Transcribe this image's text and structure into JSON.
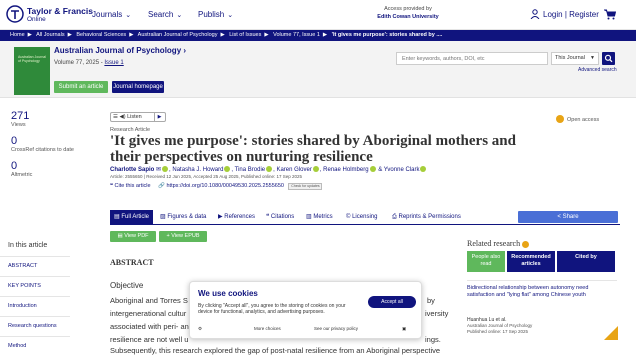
{
  "header": {
    "logo_line1": "Taylor & Francis",
    "logo_line2": "Online",
    "nav": [
      {
        "label": "Journals"
      },
      {
        "label": "Search"
      },
      {
        "label": "Publish"
      }
    ],
    "access_line1": "Access provided by",
    "access_line2": "Edith Cowan University",
    "login": "Login",
    "separator": "|",
    "register": "Register"
  },
  "breadcrumb": [
    "Home",
    "All Journals",
    "Behavioral Sciences",
    "Australian Journal of Psychology",
    "List of Issues",
    "Volume 77, Issue 1",
    "'It gives me purpose': stories shared by ...."
  ],
  "journal": {
    "cover_text": "Australian Journal of Psychology",
    "title": "Australian Journal of Psychology",
    "arrow": "›",
    "volume_prefix": "Volume 77, 2025 - ",
    "issue_link": "Issue 1",
    "submit_label": "Submit an article",
    "home_label": "Journal homepage"
  },
  "search": {
    "placeholder": "Enter keywords, authors, DOI, etc",
    "scope": "This Journal",
    "advanced": "Advanced search"
  },
  "metrics": [
    {
      "value": "271",
      "label": "Views"
    },
    {
      "value": "0",
      "label": "CrossRef citations to date"
    },
    {
      "value": "0",
      "label": "Altmetric"
    }
  ],
  "article": {
    "listen_label": "Listen",
    "type": "Research Article",
    "title": "'It gives me purpose': stories shared by Aboriginal mothers and their perspectives on nurturing resilience",
    "authors": [
      "Charlotte Sapio",
      "Natasha J. Howard",
      "Tina Brodie",
      "Karen Glover",
      "Renae Holmberg",
      "Yvonne Clark"
    ],
    "author_join": "& ",
    "dates": "Article: 2555650 | Received 12 Jun 2025, Accepted 25 Aug 2025, Published online: 17 Sep 2025",
    "cite_label": "Cite this article",
    "doi": "https://doi.org/10.1080/00049530.2025.2555650",
    "updates_label": "Check for updates",
    "open_access": "Open access"
  },
  "tabs": [
    {
      "label": "Full Article",
      "icon": "document-icon"
    },
    {
      "label": "Figures & data",
      "icon": "image-icon"
    },
    {
      "label": "References",
      "icon": "bookmark-icon"
    },
    {
      "label": "Citations",
      "icon": "quote-icon"
    },
    {
      "label": "Metrics",
      "icon": "bar-chart-icon"
    },
    {
      "label": "Licensing",
      "icon": "copyright-icon"
    },
    {
      "label": "Reprints & Permissions",
      "icon": "print-icon"
    }
  ],
  "share_label": "Share",
  "buttons": {
    "view_pdf": "View PDF",
    "view_epub": "View EPUB"
  },
  "sidebar": {
    "heading": "In this article",
    "items": [
      "ABSTRACT",
      "KEY POINTS",
      "Introduction",
      "Research questions",
      "Method"
    ]
  },
  "body": {
    "abstract_heading": "ABSTRACT",
    "objective_heading": "Objective",
    "lines": [
      "Aboriginal and Torres S",
      "intergenerational cultur",
      "associated with peri- an",
      "resilience are not well u",
      "Subsequently, this research explored the gap of post-natal resilience from an Aboriginal perspective"
    ],
    "right_frags": [
      "by",
      "iversity",
      "ings."
    ]
  },
  "related": {
    "heading": "Related research",
    "tabs": [
      "People also read",
      "Recommended articles",
      "Cited by"
    ],
    "items": [
      {
        "title": "Bidirectional relationship between autonomy need satisfaction and \"lying flat\" among Chinese youth"
      },
      {
        "author": "Huanhua Lu et al.",
        "journal": "Australian Journal of Psychology",
        "date": "Published online: 17 Sep 2025"
      }
    ]
  },
  "cookie": {
    "title": "We use cookies",
    "text": "By clicking \"Accept all\", you agree to the storing of cookies on your device for functional, analytics, and advertising purposes.",
    "accept": "Accept all",
    "more_choices": "More choices",
    "privacy": "See our privacy policy"
  },
  "colors": {
    "brand": "#10147e",
    "green": "#5fb85c",
    "share": "#4a6fd6",
    "open_access": "#e8a415"
  }
}
